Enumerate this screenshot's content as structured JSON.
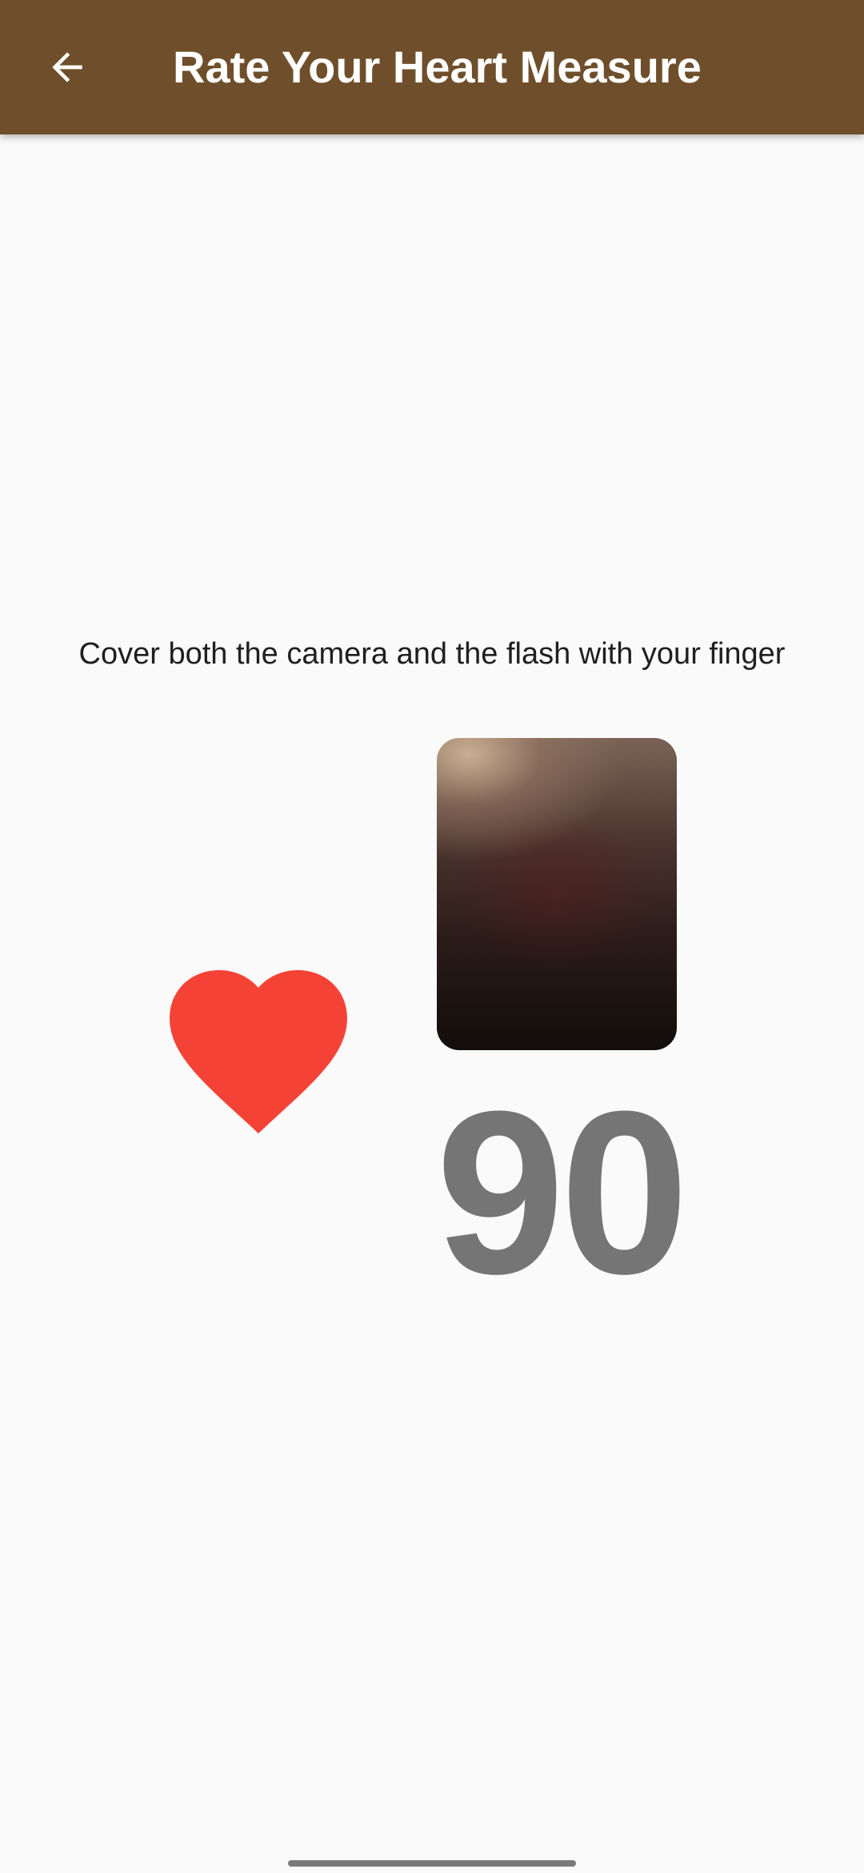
{
  "app_bar": {
    "title": "Rate Your Heart Measure",
    "back_icon": "arrow-back-icon",
    "background_color": "#6f4f2b"
  },
  "main": {
    "instruction": "Cover both the camera and the flash with your finger",
    "heart_icon": "heart-icon",
    "heart_color": "#f44336",
    "bpm_value": "90",
    "bpm_color": "#757575"
  }
}
